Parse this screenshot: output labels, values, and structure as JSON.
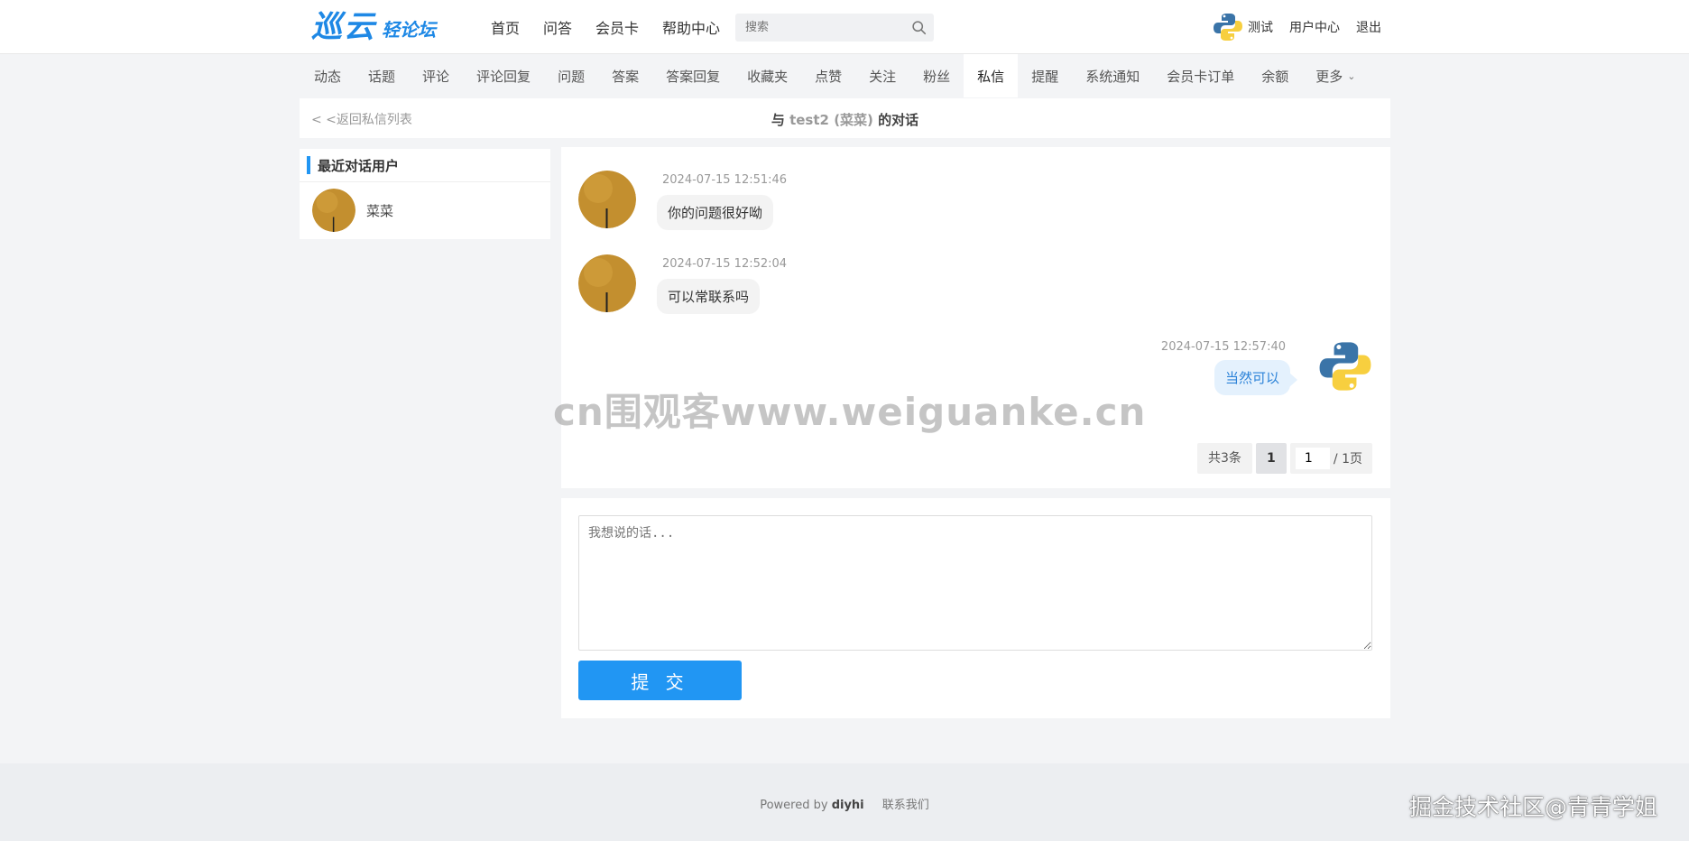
{
  "header": {
    "logo_main": "巡云",
    "logo_sub": "轻论坛",
    "nav": [
      "首页",
      "问答",
      "会员卡",
      "帮助中心"
    ],
    "search_placeholder": "搜索",
    "user_name": "测试",
    "user_center": "用户中心",
    "logout": "退出"
  },
  "subnav": {
    "items": [
      "动态",
      "话题",
      "评论",
      "评论回复",
      "问题",
      "答案",
      "答案回复",
      "收藏夹",
      "点赞",
      "关注",
      "粉丝",
      "私信",
      "提醒",
      "系统通知",
      "会员卡订单",
      "余额",
      "更多"
    ],
    "active": "私信"
  },
  "titlebar": {
    "back": "< <返回私信列表",
    "prefix": "与",
    "username": "test2",
    "nickname": "(菜菜)",
    "suffix": "的对话"
  },
  "sidebar": {
    "title": "最近对话用户",
    "contacts": [
      {
        "name": "菜菜"
      }
    ]
  },
  "messages": [
    {
      "time": "2024-07-15 12:51:46",
      "text": "你的问题很好呦",
      "side": "left"
    },
    {
      "time": "2024-07-15 12:52:04",
      "text": "可以常联系吗",
      "side": "left"
    },
    {
      "time": "2024-07-15 12:57:40",
      "text": "当然可以",
      "side": "right"
    }
  ],
  "pagination": {
    "total": "共3条",
    "current": "1",
    "jump_value": "1",
    "pages": "/ 1页"
  },
  "reply": {
    "placeholder": "我想说的话...",
    "submit": "提 交"
  },
  "footer": {
    "powered": "Powered by",
    "brand": "diyhi",
    "contact": "联系我们"
  },
  "watermarks": {
    "center": "cn围观客www.weiguanke.cn",
    "corner": "掘金技术社区@青青学姐"
  },
  "colors": {
    "accent": "#2196f3",
    "logo": "#1e88e5",
    "bubble_self": "#e4f1fd"
  }
}
